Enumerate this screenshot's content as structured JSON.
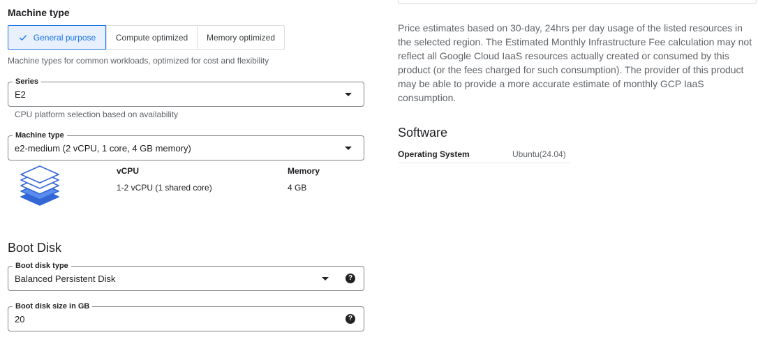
{
  "machine_type_section": {
    "title": "Machine type",
    "tabs": [
      {
        "label": "General purpose",
        "selected": true
      },
      {
        "label": "Compute optimized",
        "selected": false
      },
      {
        "label": "Memory optimized",
        "selected": false
      }
    ],
    "description": "Machine types for common workloads, optimized for cost and flexibility"
  },
  "series": {
    "label": "Series",
    "value": "E2",
    "helper": "CPU platform selection based on availability"
  },
  "machine_type_field": {
    "label": "Machine type",
    "value": "e2-medium (2 vCPU, 1 core, 4 GB memory)"
  },
  "specs": {
    "vcpu_header": "vCPU",
    "vcpu_value": "1-2 vCPU (1 shared core)",
    "memory_header": "Memory",
    "memory_value": "4 GB"
  },
  "boot_disk": {
    "title": "Boot Disk",
    "type_label": "Boot disk type",
    "type_value": "Balanced Persistent Disk",
    "size_label": "Boot disk size in GB",
    "size_value": "20",
    "help_glyph": "?"
  },
  "pricing": {
    "note": "Price estimates based on 30-day, 24hrs per day usage of the listed resources in the selected region. The Estimated Monthly Infrastructure Fee calculation may not reflect all Google Cloud IaaS resources actually created or consumed by this product (or the fees charged for such consumption). The provider of this product may be able to provide a more accurate estimate of monthly GCP IaaS consumption."
  },
  "software": {
    "title": "Software",
    "rows": [
      {
        "key": "Operating System",
        "value": "Ubuntu(24.04)"
      }
    ]
  },
  "colors": {
    "accent": "#1a73e8",
    "selected_bg": "#e8f0fe",
    "stack_icon": "#3367d6"
  },
  "icons": {
    "check": "check-icon",
    "dropdown": "chevron-down-icon",
    "help": "help-circle-icon",
    "machine": "layers-stack-icon"
  }
}
